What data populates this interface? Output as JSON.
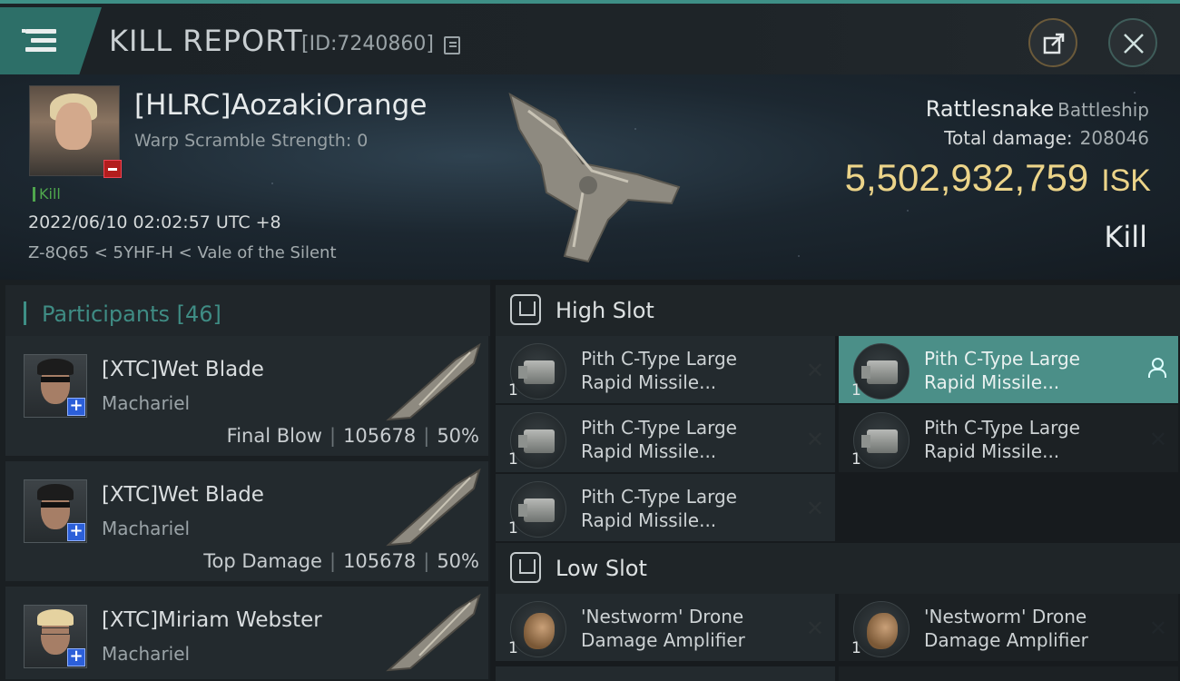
{
  "header": {
    "title": "KILL REPORT",
    "report_id": "[ID:7240860]",
    "icons": [
      "menu-icon",
      "copy-icon",
      "share-icon",
      "close-icon"
    ]
  },
  "victim": {
    "name": "[HLRC]AozakiOrange",
    "warp_scramble": "Warp Scramble Strength: 0",
    "tag": "Kill",
    "datetime": "2022/06/10 02:02:57 UTC +8",
    "location": "Z-8Q65 < 5YHF-H < Vale of the Silent",
    "ship_name": "Rattlesnake",
    "ship_class": "Battleship",
    "total_damage_label": "Total damage:",
    "total_damage": "208046",
    "isk_value": "5,502,932,759",
    "isk_unit": "ISK",
    "result": "Kill"
  },
  "participants": {
    "label": "Participants",
    "count": "[46]",
    "rows": [
      {
        "name": "[XTC]Wet Blade",
        "ship": "Machariel",
        "role": "Final Blow",
        "damage": "105678",
        "percent": "50%"
      },
      {
        "name": "[XTC]Wet Blade",
        "ship": "Machariel",
        "role": "Top Damage",
        "damage": "105678",
        "percent": "50%"
      },
      {
        "name": "[XTC]Miriam Webster",
        "ship": "Machariel"
      }
    ]
  },
  "high_slot": {
    "label": "High Slot",
    "items": [
      {
        "line1": "Pith C-Type Large",
        "line2": "Rapid Missile...",
        "qty": "1"
      },
      {
        "line1": "Pith C-Type Large",
        "line2": "Rapid Missile...",
        "qty": "1"
      },
      {
        "line1": "Pith C-Type Large",
        "line2": "Rapid Missile...",
        "qty": "1"
      },
      {
        "line1": "Pith C-Type Large",
        "line2": "Rapid Missile...",
        "qty": "1"
      },
      {
        "line1": "Pith C-Type Large",
        "line2": "Rapid Missile...",
        "qty": "1"
      }
    ]
  },
  "low_slot": {
    "label": "Low Slot",
    "items": [
      {
        "line1": "'Nestworm' Drone",
        "line2": "Damage Amplifier",
        "qty": "1"
      },
      {
        "line1": "'Nestworm' Drone",
        "line2": "Damage Amplifier",
        "qty": "1"
      }
    ]
  },
  "colors": {
    "accent_teal": "#3e8f86",
    "isk_gold": "#ecd489",
    "kill_green": "#4fa64d",
    "plus_blue": "#2c5fd9",
    "minus_red": "#b31d1d"
  }
}
